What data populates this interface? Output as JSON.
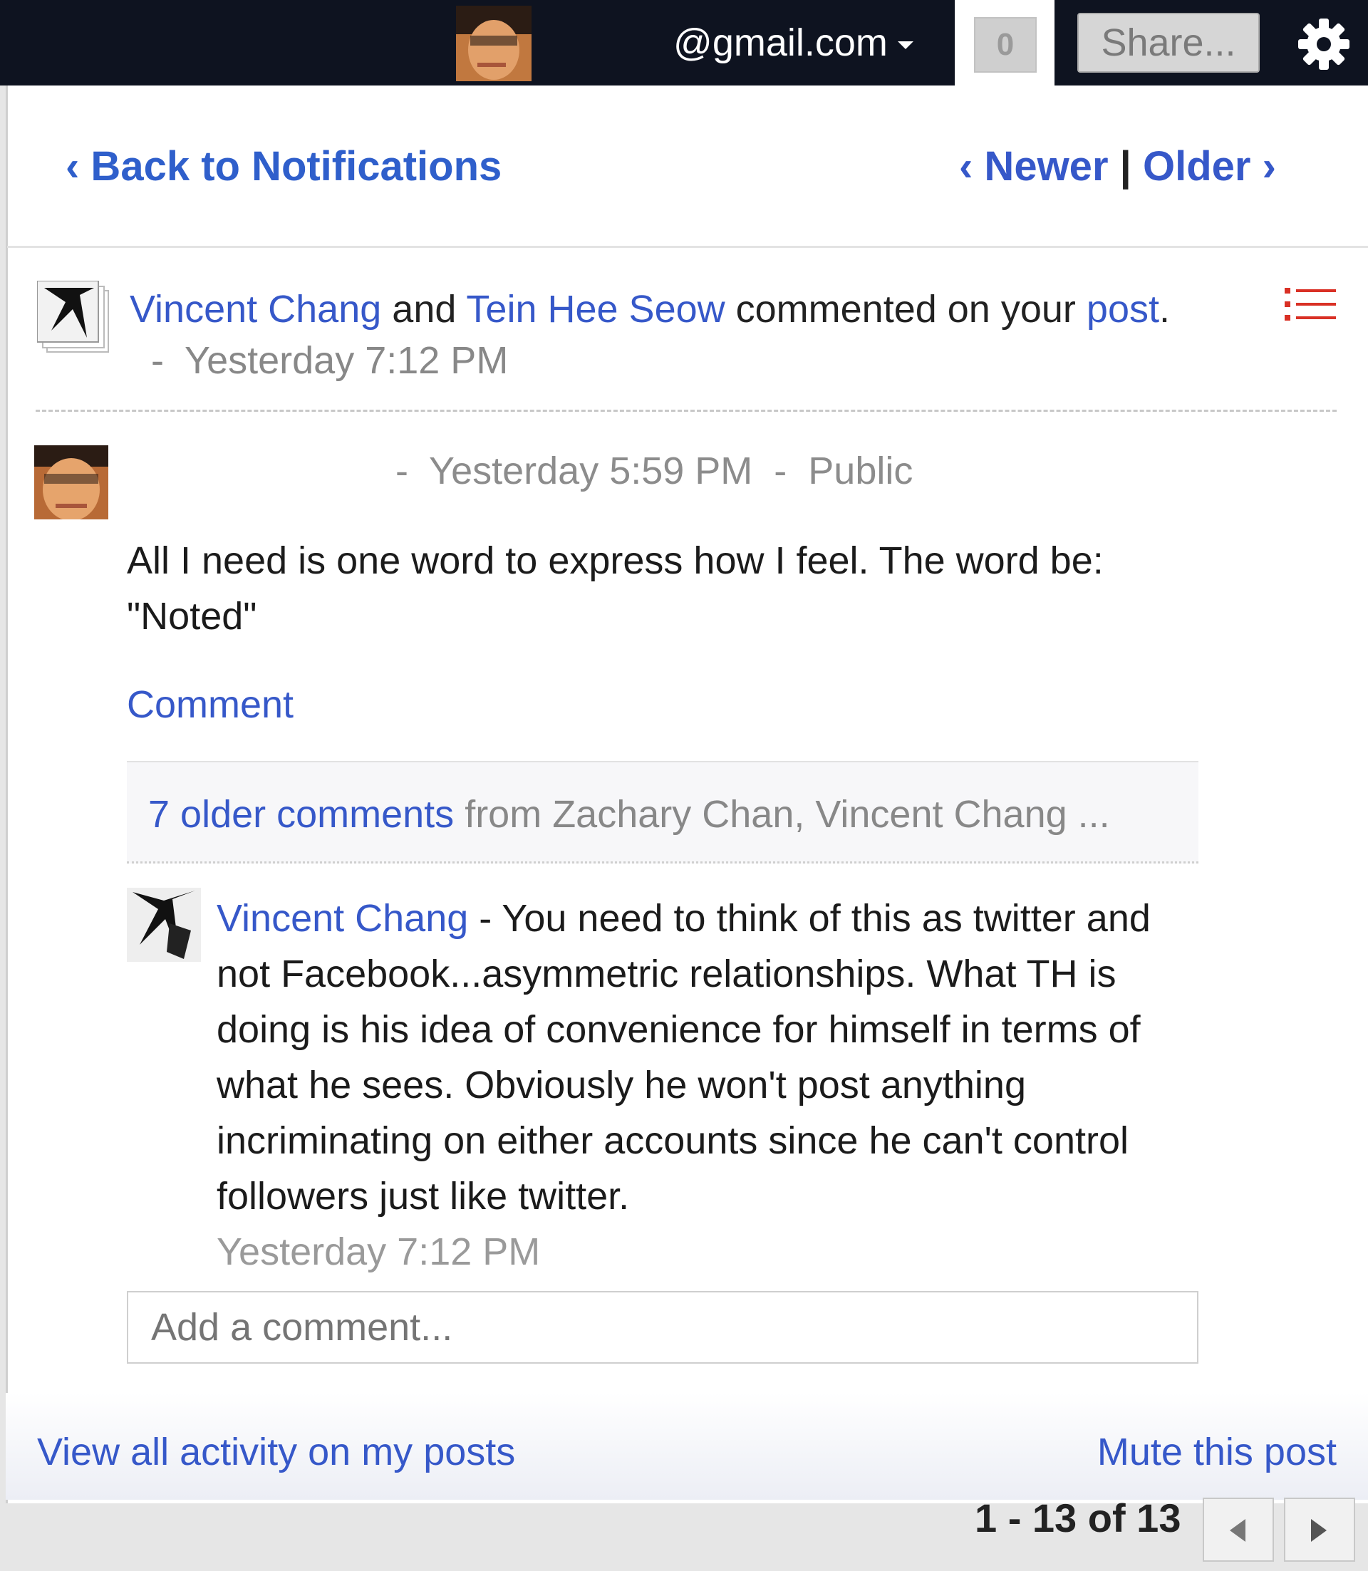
{
  "topbar": {
    "account": "@gmail.com",
    "notification_count": "0",
    "share_label": "Share...",
    "settings_icon": "gear-icon"
  },
  "nav": {
    "back": "‹ Back to Notifications",
    "newer": "‹ Newer",
    "separator": "|",
    "older": "Older ›"
  },
  "notification": {
    "user1": "Vincent Chang",
    "and": " and ",
    "user2": "Tein Hee Seow",
    "action": " commented on your ",
    "object": "post",
    "period": ".",
    "time": "  -  Yesterday 7:12 PM"
  },
  "post": {
    "meta": "-  Yesterday 5:59 PM  -  Public",
    "body": "All I need is one word to express how I feel. The word be: \"Noted\"",
    "comment_link": "Comment"
  },
  "older_comments": {
    "count_label": "7 older comments",
    "from": " from Zachary Chan, Vincent Chang ..."
  },
  "comment": {
    "author": "Vincent Chang",
    "text": " - You need to think of this as twitter and not Facebook...asymmetric relationships. What TH is doing is his idea of convenience for himself in terms of what he sees. Obviously he won't post anything incriminating on either accounts since he can't control followers just like twitter.",
    "time": "Yesterday 7:12 PM"
  },
  "add_comment": {
    "placeholder": "Add a comment..."
  },
  "footer": {
    "view_all": "View all activity on my posts",
    "mute": "Mute this post"
  },
  "pager": {
    "label": "1 - 13 of 13"
  },
  "colors": {
    "link": "#3658c9",
    "topbar": "#0e1320",
    "list_icon": "#d93025"
  }
}
